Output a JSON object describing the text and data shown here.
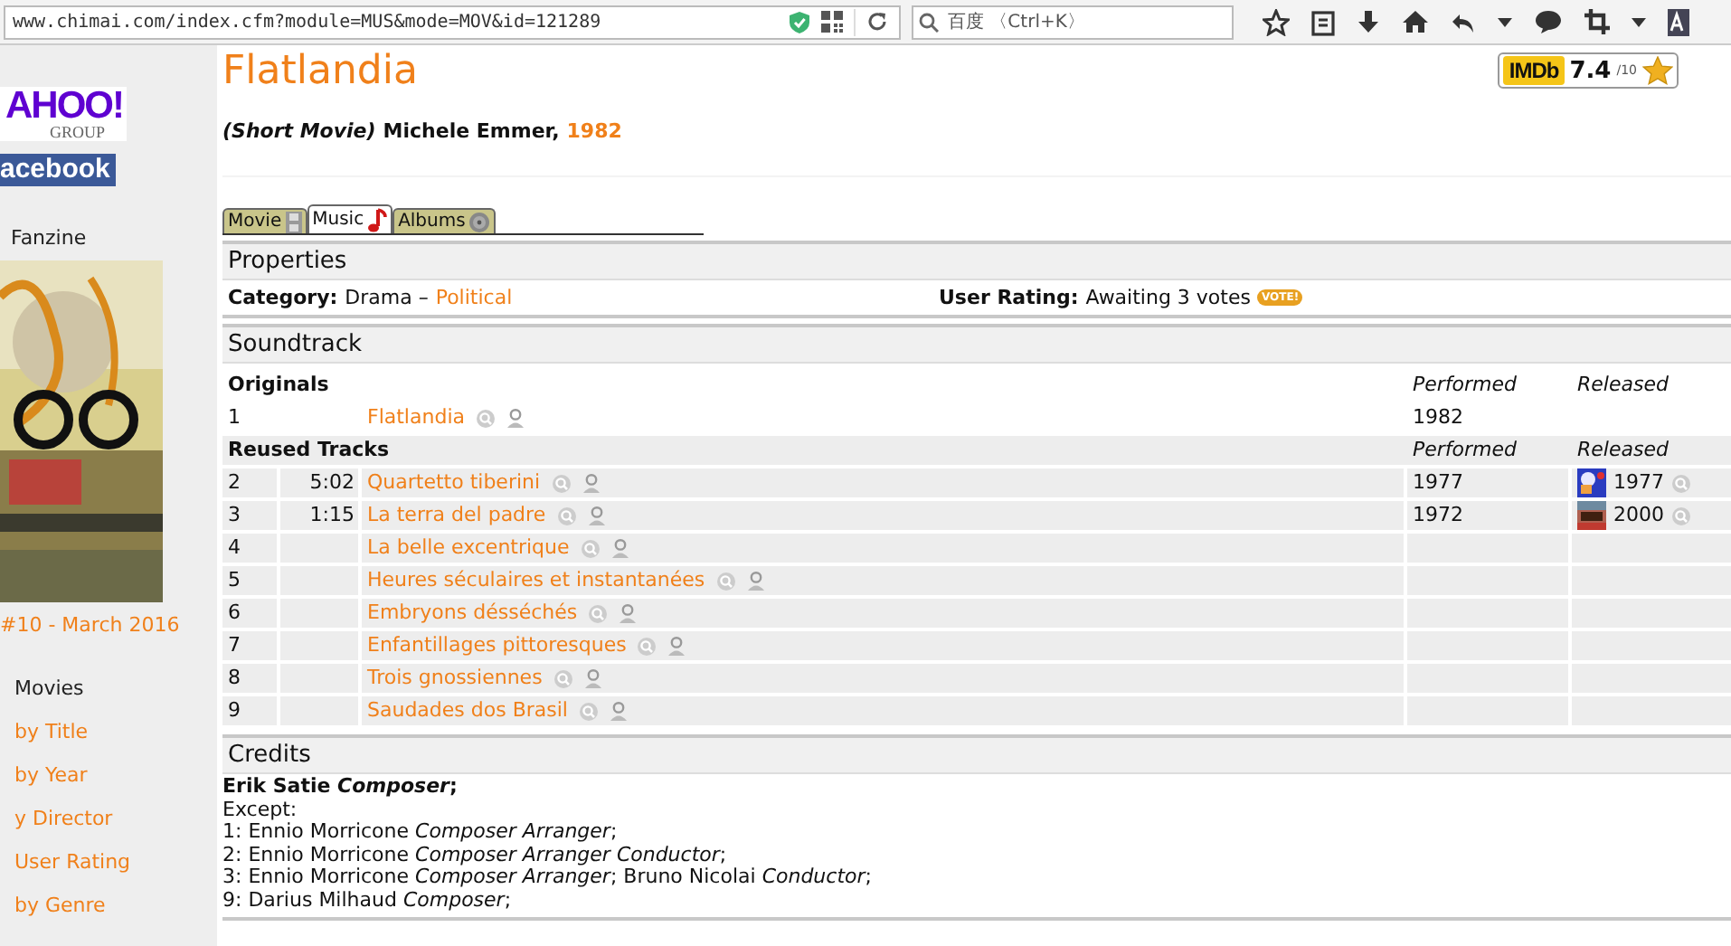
{
  "browser": {
    "url": "www.chimai.com/index.cfm?module=MUS&mode=MOV&id=121289",
    "search_placeholder": "百度 〈Ctrl+K〉"
  },
  "sidebar": {
    "logos": [
      {
        "kind": "yahoo",
        "text": "AHOO!",
        "subtext": "GROUP"
      },
      {
        "kind": "facebook",
        "text": "acebook"
      }
    ],
    "fanzine_label": "Fanzine",
    "issue": "#10 - March 2016",
    "menu": [
      {
        "kind": "heading",
        "label": "Movies"
      },
      {
        "kind": "link",
        "label": "by Title"
      },
      {
        "kind": "link",
        "label": "by Year"
      },
      {
        "kind": "link",
        "label": "y Director"
      },
      {
        "kind": "link",
        "label": "User Rating"
      },
      {
        "kind": "link",
        "label": "by Genre"
      }
    ]
  },
  "movie": {
    "title": "Flatlandia",
    "type": "(Short Movie)",
    "director": "Michele Emmer,",
    "year": "1982",
    "imdb": {
      "brand": "IMDb",
      "rating": "7.4",
      "scale": "/10"
    }
  },
  "tabs": [
    {
      "label": "Movie",
      "selected": false
    },
    {
      "label": "Music",
      "selected": true
    },
    {
      "label": "Albums",
      "selected": false
    }
  ],
  "properties": {
    "title": "Properties",
    "category_label": "Category:",
    "category": "Drama –",
    "subcategory": "Political",
    "rating_label": "User Rating:",
    "rating": "Awaiting 3 votes",
    "vote_badge": "VOTE!"
  },
  "soundtrack": {
    "title": "Soundtrack",
    "groups": [
      {
        "title": "Originals",
        "columns": [
          "Performed",
          "Released"
        ],
        "rows": [
          {
            "number": "1",
            "title": "Flatlandia",
            "performed": "1982"
          }
        ]
      },
      {
        "title": "Reused Tracks",
        "columns": [
          "Performed",
          "Released"
        ],
        "rows": [
          {
            "number": "2",
            "duration": "5:02",
            "title": "Quartetto tiberini",
            "performed": "1977",
            "released": "1977"
          },
          {
            "number": "3",
            "duration": "1:15",
            "title": "La terra del padre",
            "performed": "1972",
            "released": "2000"
          },
          {
            "number": "4",
            "title": "La belle excentrique"
          },
          {
            "number": "5",
            "title": "Heures séculaires et instantanées"
          },
          {
            "number": "6",
            "title": "Embryons désséchés"
          },
          {
            "number": "7",
            "title": "Enfantillages pittoresques"
          },
          {
            "number": "8",
            "title": "Trois gnossiennes"
          },
          {
            "number": "9",
            "title": "Saudades dos Brasil"
          }
        ]
      }
    ]
  },
  "credits": {
    "title": "Credits",
    "main": "Erik Satie *Composer*;",
    "except": "Except:",
    "lines": [
      "1: Ennio Morricone *Composer Arranger*;",
      "2: Ennio Morricone *Composer Arranger Conductor*;",
      "3: Ennio Morricone *Composer Arranger*; Bruno Nicolai *Conductor*;",
      "9: Darius Milhaud *Composer*;"
    ]
  }
}
